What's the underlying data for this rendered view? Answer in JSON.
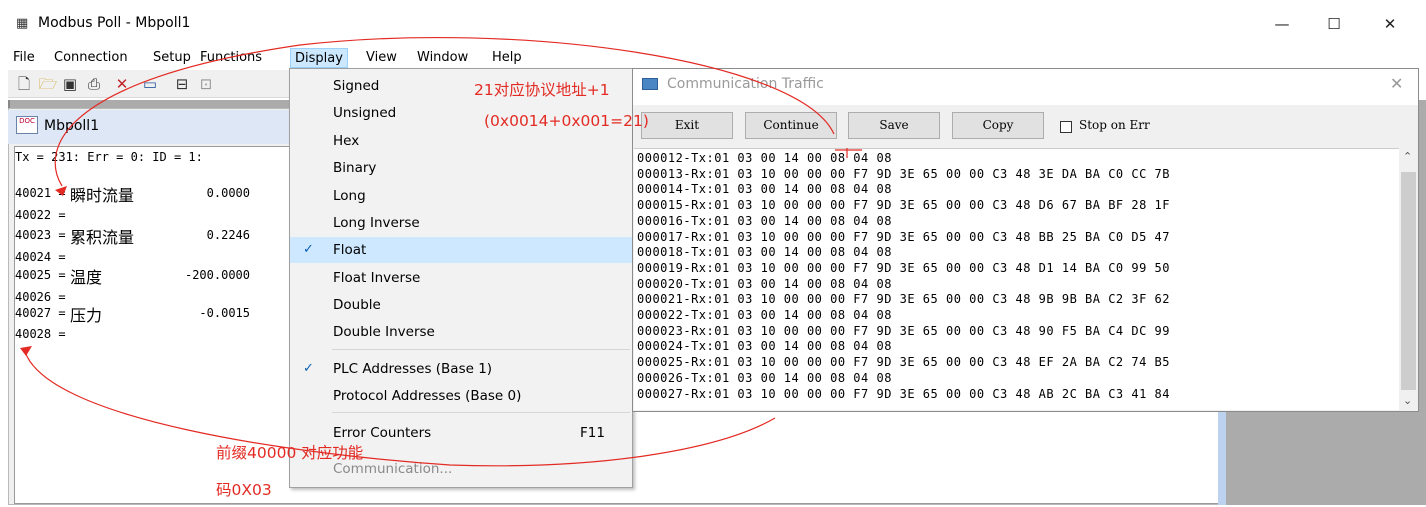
{
  "window": {
    "title": "Modbus Poll - Mbpoll1",
    "app_icon": "grid-icon",
    "minimize": "—",
    "maximize": "☐",
    "close": "✕"
  },
  "menubar": [
    "File",
    "Connection",
    "Setup",
    "Functions",
    "Display",
    "View",
    "Window",
    "Help"
  ],
  "toolbar": {
    "icons": [
      "new-doc-icon",
      "open-folder-icon",
      "save-icon",
      "print-icon",
      "delete-icon",
      "window-icon",
      "read-icon",
      "write-icon"
    ]
  },
  "doc": {
    "title": "Mbpoll1",
    "status": "Tx = 231: Err = 0: ID = 1:",
    "rows": [
      {
        "addr": "40021 =",
        "name": "瞬时流量",
        "value": "0.0000"
      },
      {
        "addr": "40022 =",
        "name": "",
        "value": ""
      },
      {
        "addr": "40023 =",
        "name": "累积流量",
        "value": "0.2246"
      },
      {
        "addr": "40024 =",
        "name": "",
        "value": ""
      },
      {
        "addr": "40025 =",
        "name": "温度",
        "value": "-200.0000"
      },
      {
        "addr": "40026 =",
        "name": "",
        "value": ""
      },
      {
        "addr": "40027 =",
        "name": "压力",
        "value": "-0.0015"
      },
      {
        "addr": "40028 =",
        "name": "",
        "value": ""
      }
    ]
  },
  "display_menu": {
    "items": [
      {
        "label": "Signed",
        "checked": false,
        "selected": false
      },
      {
        "label": "Unsigned",
        "checked": false,
        "selected": false
      },
      {
        "label": "Hex",
        "checked": false,
        "selected": false
      },
      {
        "label": "Binary",
        "checked": false,
        "selected": false
      },
      {
        "label": "Long",
        "checked": false,
        "selected": false
      },
      {
        "label": "Long Inverse",
        "checked": false,
        "selected": false
      },
      {
        "label": "Float",
        "checked": true,
        "selected": true
      },
      {
        "label": "Float Inverse",
        "checked": false,
        "selected": false
      },
      {
        "label": "Double",
        "checked": false,
        "selected": false
      },
      {
        "label": "Double Inverse",
        "checked": false,
        "selected": false
      }
    ],
    "address_items": [
      {
        "label": "PLC Addresses (Base 1)",
        "checked": true
      },
      {
        "label": "Protocol Addresses (Base 0)",
        "checked": false
      }
    ],
    "error_counters": {
      "label": "Error Counters",
      "shortcut": "F11"
    },
    "communication": {
      "label": "Communication..."
    }
  },
  "traffic": {
    "title": "Communication Traffic",
    "buttons": [
      "Exit",
      "Continue",
      "Save",
      "Copy"
    ],
    "stop_on_err": "Stop on Err",
    "lines": [
      "000012-Tx:01 03 00 14 00 08 04 08",
      "000013-Rx:01 03 10 00 00 00 F7 9D 3E 65 00 00 C3 48 3E DA BA C0 CC 7B",
      "000014-Tx:01 03 00 14 00 08 04 08",
      "000015-Rx:01 03 10 00 00 00 F7 9D 3E 65 00 00 C3 48 D6 67 BA BF 28 1F",
      "000016-Tx:01 03 00 14 00 08 04 08",
      "000017-Rx:01 03 10 00 00 00 F7 9D 3E 65 00 00 C3 48 BB 25 BA C0 D5 47",
      "000018-Tx:01 03 00 14 00 08 04 08",
      "000019-Rx:01 03 10 00 00 00 F7 9D 3E 65 00 00 C3 48 D1 14 BA C0 99 50",
      "000020-Tx:01 03 00 14 00 08 04 08",
      "000021-Rx:01 03 10 00 00 00 F7 9D 3E 65 00 00 C3 48 9B 9B BA C2 3F 62",
      "000022-Tx:01 03 00 14 00 08 04 08",
      "000023-Rx:01 03 10 00 00 00 F7 9D 3E 65 00 00 C3 48 90 F5 BA C4 DC 99",
      "000024-Tx:01 03 00 14 00 08 04 08",
      "000025-Rx:01 03 10 00 00 00 F7 9D 3E 65 00 00 C3 48 EF 2A BA C2 74 B5",
      "000026-Tx:01 03 00 14 00 08 04 08",
      "000027-Rx:01 03 10 00 00 00 F7 9D 3E 65 00 00 C3 48 AB 2C BA C3 41 84"
    ]
  },
  "annotations": {
    "addr_note_1": "21对应协议地址+1",
    "addr_note_2": "(0x0014+0x001=21)",
    "prefix_note_1": "前缀40000 对应功能",
    "prefix_note_2": "码0X03",
    "color": "#e32b24"
  }
}
